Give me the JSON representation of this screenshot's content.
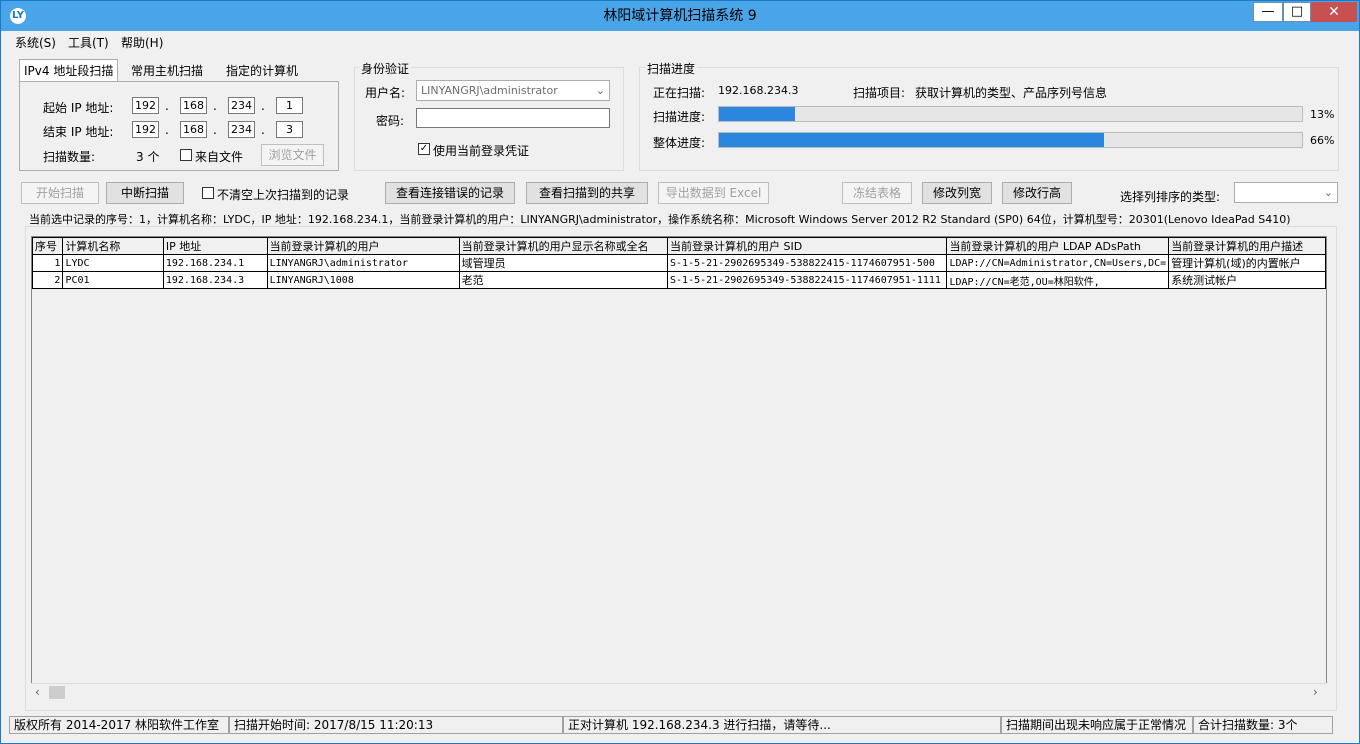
{
  "window": {
    "title": "林阳域计算机扫描系统 9",
    "icon_text": "LY",
    "minimize": "—",
    "maximize": "□",
    "close": "✕"
  },
  "menu": {
    "items": [
      "系统(S)",
      "工具(T)",
      "帮助(H)"
    ]
  },
  "tabs": [
    "IPv4 地址段扫描",
    "常用主机扫描",
    "指定的计算机"
  ],
  "ipv4": {
    "start_label": "起始 IP 地址:",
    "start_ip": [
      "192",
      "168",
      "234",
      "1"
    ],
    "end_label": "结束 IP 地址:",
    "end_ip": [
      "192",
      "168",
      "234",
      "3"
    ],
    "count_label": "扫描数量:",
    "count_value": "3 个",
    "from_file_label": "来自文件",
    "browse_label": "浏览文件"
  },
  "auth": {
    "title": "身份验证",
    "username_label": "用户名:",
    "username_value": "LINYANGRJ\\administrator",
    "password_label": "密码:",
    "password_value": "",
    "use_current_label": "使用当前登录凭证",
    "use_current_checked": true
  },
  "progress": {
    "title": "扫描进度",
    "scanning_label": "正在扫描:",
    "scanning_value": "192.168.234.3",
    "item_label": "扫描项目:",
    "item_value": "获取计算机的类型、产品序列号信息",
    "scan_label": "扫描进度:",
    "scan_percent": 13,
    "scan_percent_text": "13%",
    "overall_label": "整体进度:",
    "overall_percent": 66,
    "overall_percent_text": "66%"
  },
  "toolbar": {
    "start": "开始扫描",
    "stop": "中断扫描",
    "no_clear_label": "不清空上次扫描到的记录",
    "view_errors": "查看连接错误的记录",
    "view_shares": "查看扫描到的共享",
    "export": "导出数据到 Excel",
    "freeze": "冻结表格",
    "col_width": "修改列宽",
    "row_height": "修改行高",
    "sort_label": "选择列排序的类型:"
  },
  "selected_info": "当前选中记录的序号：1，计算机名称：LYDC，IP 地址：192.168.234.1，当前登录计算机的用户：LINYANGRJ\\administrator，操作系统名称：Microsoft Windows Server 2012 R2 Standard (SP0) 64位，计算机型号：20301(Lenovo IdeaPad S410)",
  "grid": {
    "headers": [
      "序号",
      "计算机名称",
      "IP 地址",
      "当前登录计算机的用户",
      "当前登录计算机的用户显示名称或全名",
      "当前登录计算机的用户 SID",
      "当前登录计算机的用户 LDAP ADsPath",
      "当前登录计算机的用户描述"
    ],
    "rows": [
      [
        "1",
        "LYDC",
        "192.168.234.1",
        "LINYANGRJ\\administrator",
        "域管理员",
        "S-1-5-21-2902695349-538822415-1174607951-500",
        "LDAP://CN=Administrator,CN=Users,DC=",
        "管理计算机(域)的内置帐户"
      ],
      [
        "2",
        "PC01",
        "192.168.234.3",
        "LINYANGRJ\\1008",
        "老范",
        "S-1-5-21-2902695349-538822415-1174607951-1111",
        "LDAP://CN=老范,OU=林阳软件,",
        "系统测试帐户"
      ]
    ]
  },
  "status": {
    "copyright": "版权所有 2014-2017 林阳软件工作室",
    "start_time": "扫描开始时间: 2017/8/15 11:20:13",
    "current": "正对计算机 192.168.234.3 进行扫描，请等待...",
    "note": "扫描期间出现未响应属于正常情况",
    "total": "合计扫描数量: 3个"
  },
  "colors": {
    "accent": "#2a86de",
    "titlebar": "#49a4e8",
    "close": "#c75050"
  }
}
